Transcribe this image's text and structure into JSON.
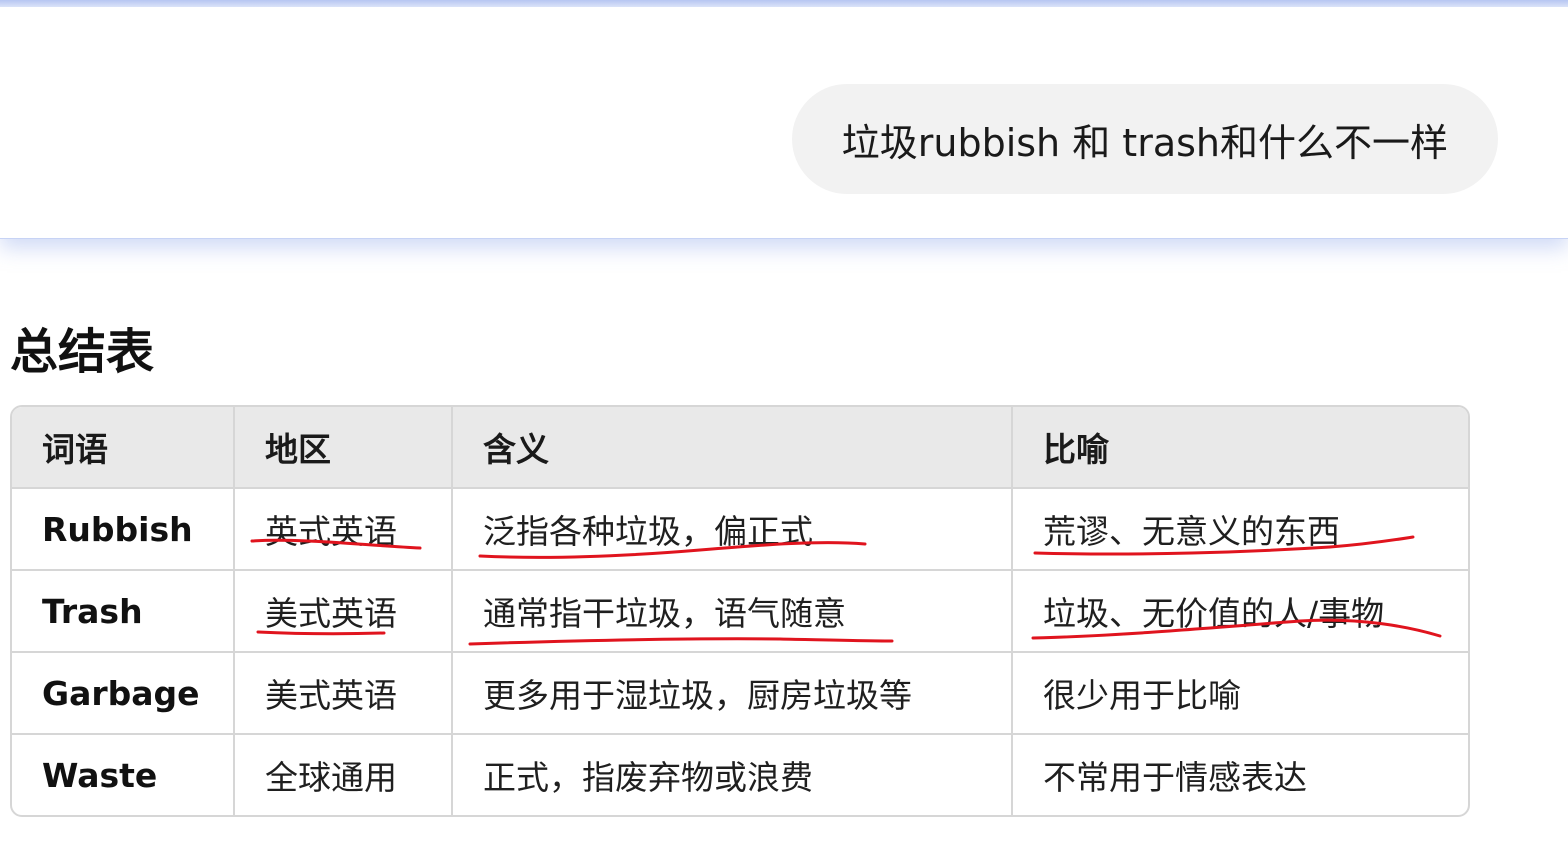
{
  "chat": {
    "user_message": "垃圾rubbish 和 trash和什么不一样"
  },
  "summary": {
    "heading": "总结表",
    "columns": [
      "词语",
      "地区",
      "含义",
      "比喻"
    ],
    "rows": [
      {
        "word": "Rubbish",
        "region": "英式英语",
        "meaning": "泛指各种垃圾，偏正式",
        "metaphor": "荒谬、无意义的东西"
      },
      {
        "word": "Trash",
        "region": "美式英语",
        "meaning": "通常指干垃圾，语气随意",
        "metaphor": "垃圾、无价值的人/事物"
      },
      {
        "word": "Garbage",
        "region": "美式英语",
        "meaning": "更多用于湿垃圾，厨房垃圾等",
        "metaphor": "很少用于比喻"
      },
      {
        "word": "Waste",
        "region": "全球通用",
        "meaning": "正式，指废弃物或浪费",
        "metaphor": "不常用于情感表达"
      }
    ]
  },
  "annotations": {
    "underline_color": "#e0141e"
  }
}
